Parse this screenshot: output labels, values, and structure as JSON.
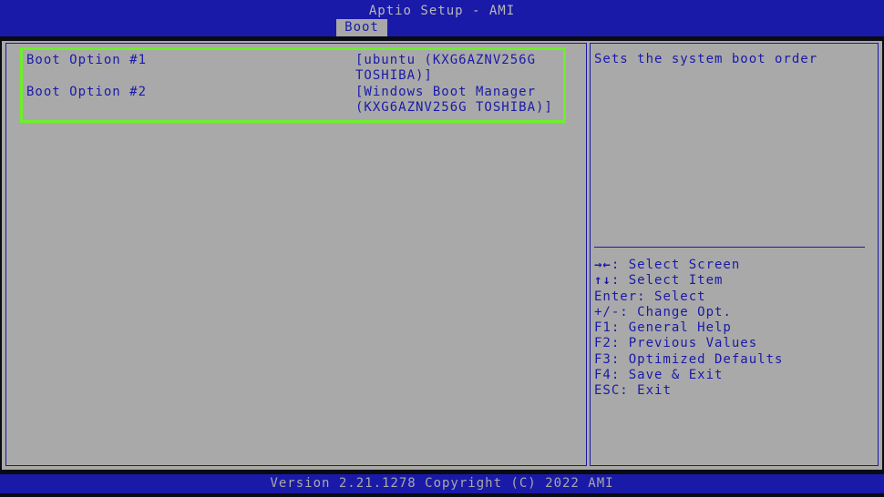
{
  "header": {
    "title": "Aptio Setup - AMI",
    "active_tab": "Boot"
  },
  "boot_options": [
    {
      "label": "Boot Option #1",
      "value": "[ubuntu (KXG6AZNV256G TOSHIBA)]"
    },
    {
      "label": "Boot Option #2",
      "value": "[Windows Boot Manager (KXG6AZNV256G TOSHIBA)]"
    }
  ],
  "help_panel": {
    "description": "Sets the system boot order",
    "keys": [
      {
        "key": "→←",
        "action": ": Select Screen"
      },
      {
        "key": "↑↓",
        "action": ": Select Item"
      },
      {
        "key": "Enter",
        "action": ": Select"
      },
      {
        "key": "+/-",
        "action": ": Change Opt."
      },
      {
        "key": "F1",
        "action": ": General Help"
      },
      {
        "key": "F2",
        "action": ": Previous Values"
      },
      {
        "key": "F3",
        "action": ": Optimized Defaults"
      },
      {
        "key": "F4",
        "action": ": Save & Exit"
      },
      {
        "key": "ESC",
        "action": ": Exit"
      }
    ]
  },
  "footer": {
    "text": "Version 2.21.1278 Copyright (C) 2022 AMI"
  },
  "colors": {
    "bios_blue": "#1a1aa8",
    "panel_gray": "#a9a9a9",
    "highlight_green": "#6cf02a"
  }
}
